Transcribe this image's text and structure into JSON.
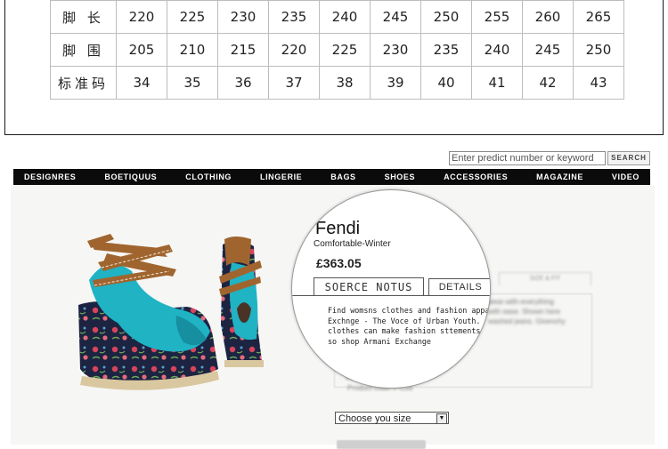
{
  "size_chart": {
    "rows": [
      {
        "label": "脚 长",
        "values": [
          "220",
          "225",
          "230",
          "235",
          "240",
          "245",
          "250",
          "255",
          "260",
          "265"
        ]
      },
      {
        "label": "脚 围",
        "values": [
          "205",
          "210",
          "215",
          "220",
          "225",
          "230",
          "235",
          "240",
          "245",
          "250"
        ]
      },
      {
        "label": "标准码",
        "values": [
          "34",
          "35",
          "36",
          "37",
          "38",
          "39",
          "40",
          "41",
          "42",
          "43"
        ]
      }
    ]
  },
  "search": {
    "placeholder": "Enter predict number or keyword",
    "button_label": "SEARCH"
  },
  "nav": {
    "items": [
      "DESIGNRES",
      "BOETIQUUS",
      "CLOTHING",
      "LINGERIE",
      "BAGS",
      "SHOES",
      "ACCESSORIES",
      "MAGAZINE",
      "VIDEO"
    ]
  },
  "product": {
    "brand": "Fendi",
    "subtitle": "Comfortable-Winter",
    "price": "£363.05",
    "tabs": [
      "SOERCE NOTUS",
      "DETAILS"
    ],
    "description": [
      "Find womsns clothes and fashion appar",
      "Exchnge - The Voce of Urban Youth.",
      " clothes can make fashion sttements",
      "so shop Armani Exchange"
    ],
    "size_select": "Choose you size"
  },
  "colors": {
    "nav_bg": "#0b0b0b",
    "shoe_turquoise": "#1fb3c4",
    "strap_brown": "#a0652f",
    "wedge_navy": "#1c2442"
  }
}
